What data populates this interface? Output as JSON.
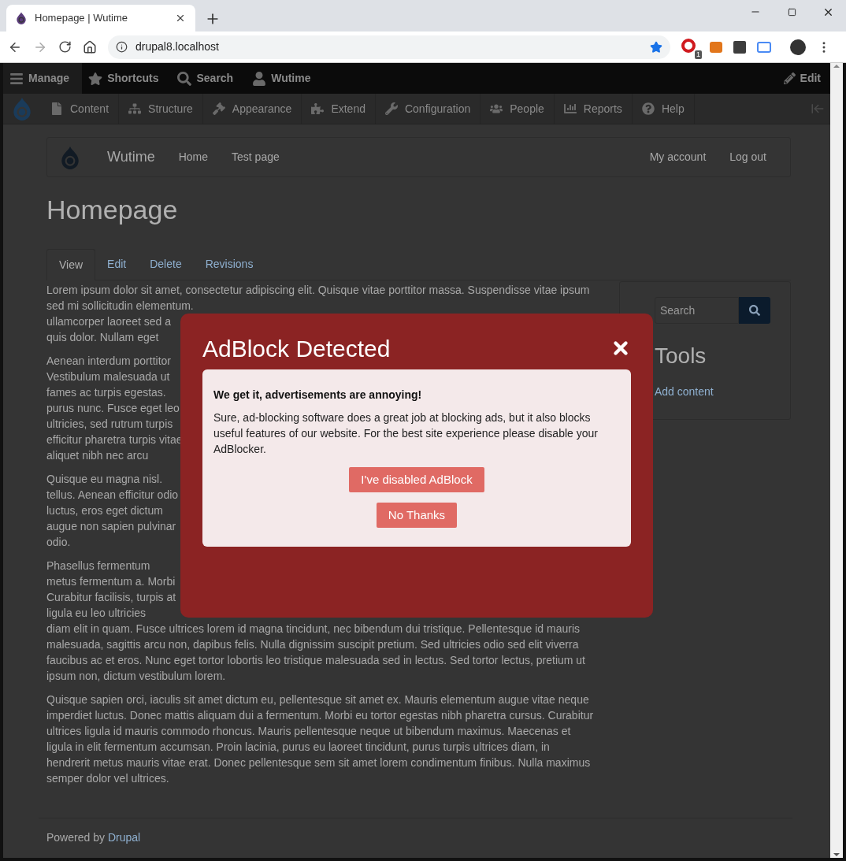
{
  "browser": {
    "tab_title": "Homepage | Wutime",
    "address": "drupal8.localhost",
    "extension_badge": "1"
  },
  "admin_toolbar": {
    "items": [
      {
        "kind": "menu",
        "label": "Manage",
        "selected": true
      },
      {
        "kind": "star",
        "label": "Shortcuts",
        "selected": false
      },
      {
        "kind": "search",
        "label": "Search",
        "selected": false
      },
      {
        "kind": "user",
        "label": "Wutime",
        "selected": false
      }
    ],
    "edit": "Edit"
  },
  "admin_menu": [
    {
      "kind": "content",
      "label": "Content"
    },
    {
      "kind": "structure",
      "label": "Structure"
    },
    {
      "kind": "appearance",
      "label": "Appearance"
    },
    {
      "kind": "extend",
      "label": "Extend"
    },
    {
      "kind": "configuration",
      "label": "Configuration"
    },
    {
      "kind": "people",
      "label": "People"
    },
    {
      "kind": "reports",
      "label": "Reports"
    },
    {
      "kind": "help",
      "label": "Help"
    }
  ],
  "site": {
    "name": "Wutime",
    "nav": [
      "Home",
      "Test page"
    ],
    "account_nav": [
      "My account",
      "Log out"
    ]
  },
  "page_title": "Homepage",
  "tabs": [
    {
      "label": "View",
      "selected": true
    },
    {
      "label": "Edit",
      "selected": false
    },
    {
      "label": "Delete",
      "selected": false
    },
    {
      "label": "Revisions",
      "selected": false
    }
  ],
  "paragraphs": [
    {
      "lines": [
        "Lorem ipsum dolor sit amet, consectetur adipiscing elit. Quisque vitae porttitor massa. Suspendisse vitae ipsum",
        "sed mi sollicitudin elementum.",
        "ullamcorper laoreet sed a",
        "quis dolor. Nullam eget"
      ]
    },
    {
      "lines": [
        "Aenean interdum porttitor",
        "Vestibulum malesuada ut",
        "fames ac turpis egestas.",
        "purus nunc. Fusce eget leo",
        "ultricies, sed rutrum turpis",
        "efficitur pharetra turpis vitae",
        "aliquet nibh nec arcu"
      ]
    },
    {
      "lines": [
        "Quisque eu magna nisl.",
        "tellus. Aenean efficitur odio",
        "luctus, eros eget dictum",
        "augue non sapien pulvinar",
        "odio."
      ]
    },
    {
      "lines": [
        "Phasellus fermentum",
        "metus fermentum a. Morbi",
        "Curabitur facilisis, turpis at",
        "ligula eu leo ultricies",
        "diam elit in quam. Fusce ultrices lorem id magna tincidunt, nec bibendum dui tristique. Pellentesque id mauris",
        "malesuada, sagittis arcu non, dapibus felis. Nulla dignissim suscipit pretium. Sed ultricies odio sed elit viverra",
        "faucibus ac et eros. Nunc eget tortor lobortis leo tristique malesuada sed in lectus. Sed tortor lectus, pretium ut",
        "ipsum non, dictum vestibulum lorem."
      ]
    },
    {
      "lines": [
        "Quisque sapien orci, iaculis sit amet dictum eu, pellentesque sit amet ex. Mauris elementum augue vitae neque",
        "imperdiet luctus. Donec mattis aliquam dui a fermentum. Morbi eu tortor egestas nibh pharetra cursus. Curabitur",
        "ultrices ligula id mauris commodo rhoncus. Mauris pellentesque neque ut bibendum maximus. Maecenas et",
        "ligula in elit fermentum accumsan. Proin lacinia, purus eu laoreet tincidunt, purus turpis ultrices diam, in",
        "hendrerit metus mauris vitae erat. Donec pellentesque sem sit amet lorem condimentum finibus. Nulla maximus",
        "semper dolor vel ultrices."
      ]
    }
  ],
  "sidebar": {
    "search_placeholder": "Search",
    "block_title": "Tools",
    "links": [
      "Add content"
    ]
  },
  "footer": {
    "text": "Powered by",
    "link": "Drupal"
  },
  "modal": {
    "title": "AdBlock Detected",
    "heading": "We get it, advertisements are annoying!",
    "message": "Sure, ad-blocking software does a great job at blocking ads, but it also blocks useful features of our website. For the best site experience please disable your AdBlocker.",
    "buttons": [
      "I've disabled AdBlock",
      "No Thanks"
    ]
  }
}
